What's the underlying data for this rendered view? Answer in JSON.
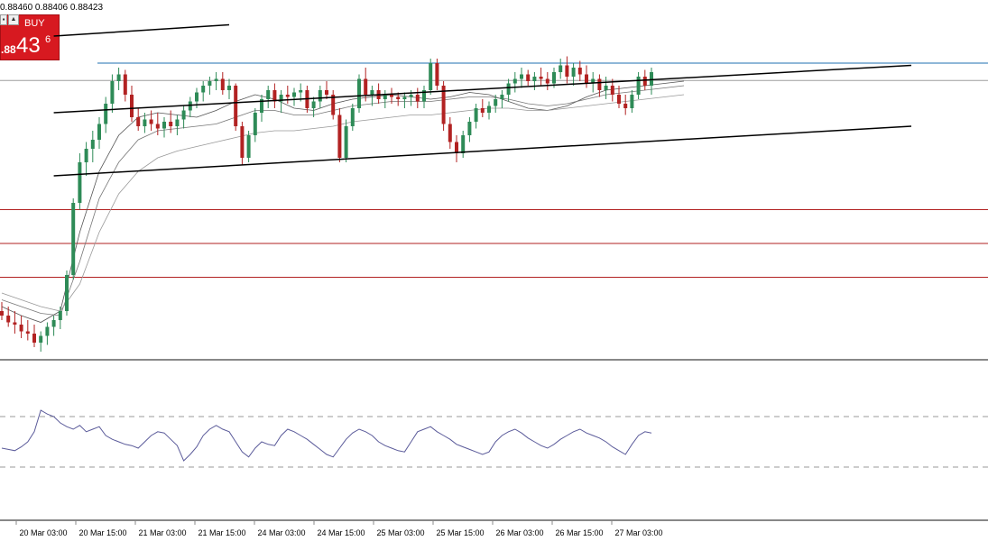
{
  "header": {
    "ohlc_text": "0.88460 0.88406 0.88423"
  },
  "trade_panel": {
    "buy_label": "BUY",
    "price_prefix": ".88",
    "price_big": "43",
    "price_sup": "6",
    "buy_color": "#d71920",
    "collapse_glyph": "▪",
    "up_glyph": "▲"
  },
  "colors": {
    "candle_up": "#2e8b57",
    "candle_down": "#b22222",
    "trendline": "#000000",
    "support_line": "#b22222",
    "resistance_line": "#1f6fb2",
    "current_price_line": "#9e9e9e",
    "rsi_line": "#5b5b9a"
  },
  "chart_data": {
    "type": "candlestick",
    "x_axis_labels": [
      "20 Mar 03:00",
      "20 Mar 15:00",
      "21 Mar 03:00",
      "21 Mar 15:00",
      "24 Mar 03:00",
      "24 Mar 15:00",
      "25 Mar 03:00",
      "25 Mar 15:00",
      "26 Mar 03:00",
      "26 Mar 15:00",
      "27 Mar 03:00"
    ],
    "x_axis_tick_centers": [
      48,
      114,
      180,
      246,
      312,
      378,
      444,
      510,
      576,
      642,
      708
    ],
    "candles": [
      [
        0,
        0.874,
        0.8744,
        0.8736,
        0.8738
      ],
      [
        1,
        0.8738,
        0.8742,
        0.8733,
        0.8735
      ],
      [
        2,
        0.8735,
        0.874,
        0.873,
        0.8734
      ],
      [
        3,
        0.8734,
        0.8738,
        0.8728,
        0.8731
      ],
      [
        4,
        0.8731,
        0.8736,
        0.8727,
        0.873
      ],
      [
        5,
        0.873,
        0.8734,
        0.8724,
        0.8726
      ],
      [
        6,
        0.8726,
        0.8731,
        0.8722,
        0.8729
      ],
      [
        7,
        0.8729,
        0.8735,
        0.8725,
        0.8733
      ],
      [
        8,
        0.8733,
        0.8738,
        0.8729,
        0.8736
      ],
      [
        9,
        0.8736,
        0.8742,
        0.8732,
        0.874
      ],
      [
        10,
        0.874,
        0.8758,
        0.8738,
        0.8756
      ],
      [
        11,
        0.8756,
        0.879,
        0.8754,
        0.8788
      ],
      [
        12,
        0.8788,
        0.881,
        0.8785,
        0.8806
      ],
      [
        13,
        0.8806,
        0.8815,
        0.88,
        0.8812
      ],
      [
        14,
        0.8812,
        0.882,
        0.8806,
        0.8816
      ],
      [
        15,
        0.8816,
        0.8826,
        0.8812,
        0.8823
      ],
      [
        16,
        0.8823,
        0.8835,
        0.8819,
        0.8832
      ],
      [
        17,
        0.8832,
        0.8845,
        0.8828,
        0.8842
      ],
      [
        18,
        0.8842,
        0.8848,
        0.8838,
        0.8845
      ],
      [
        19,
        0.8845,
        0.8847,
        0.8833,
        0.8836
      ],
      [
        20,
        0.8836,
        0.884,
        0.8824,
        0.8826
      ],
      [
        21,
        0.8826,
        0.883,
        0.882,
        0.8822
      ],
      [
        22,
        0.8822,
        0.8828,
        0.8819,
        0.8825
      ],
      [
        23,
        0.8825,
        0.8829,
        0.882,
        0.8823
      ],
      [
        24,
        0.8823,
        0.8828,
        0.8818,
        0.8821
      ],
      [
        25,
        0.8821,
        0.8826,
        0.8817,
        0.8824
      ],
      [
        26,
        0.8824,
        0.8829,
        0.8819,
        0.8822
      ],
      [
        27,
        0.8822,
        0.8827,
        0.8818,
        0.8825
      ],
      [
        28,
        0.8825,
        0.8831,
        0.8821,
        0.8829
      ],
      [
        29,
        0.8829,
        0.8835,
        0.8826,
        0.8833
      ],
      [
        30,
        0.8833,
        0.8839,
        0.883,
        0.8837
      ],
      [
        31,
        0.8837,
        0.8842,
        0.8833,
        0.884
      ],
      [
        32,
        0.884,
        0.8844,
        0.8836,
        0.8842
      ],
      [
        33,
        0.8842,
        0.8846,
        0.8838,
        0.8843
      ],
      [
        34,
        0.8843,
        0.8846,
        0.8836,
        0.8838
      ],
      [
        35,
        0.8838,
        0.8843,
        0.8834,
        0.884
      ],
      [
        36,
        0.884,
        0.8841,
        0.882,
        0.8822
      ],
      [
        37,
        0.8822,
        0.8824,
        0.8805,
        0.8808
      ],
      [
        38,
        0.8808,
        0.882,
        0.8806,
        0.8818
      ],
      [
        39,
        0.8818,
        0.883,
        0.8815,
        0.8828
      ],
      [
        40,
        0.8828,
        0.8836,
        0.8824,
        0.8834
      ],
      [
        41,
        0.8834,
        0.884,
        0.883,
        0.8838
      ],
      [
        42,
        0.8838,
        0.8841,
        0.883,
        0.8833
      ],
      [
        43,
        0.8833,
        0.8838,
        0.8828,
        0.8836
      ],
      [
        44,
        0.8836,
        0.884,
        0.8832,
        0.8835
      ],
      [
        45,
        0.8835,
        0.8839,
        0.8831,
        0.8837
      ],
      [
        46,
        0.8837,
        0.8841,
        0.8833,
        0.8838
      ],
      [
        47,
        0.8838,
        0.884,
        0.8828,
        0.883
      ],
      [
        48,
        0.883,
        0.8835,
        0.8826,
        0.8833
      ],
      [
        49,
        0.8833,
        0.884,
        0.883,
        0.8838
      ],
      [
        50,
        0.8838,
        0.8842,
        0.8834,
        0.8836
      ],
      [
        51,
        0.8836,
        0.8838,
        0.8825,
        0.8827
      ],
      [
        52,
        0.8827,
        0.883,
        0.8806,
        0.8808
      ],
      [
        53,
        0.8808,
        0.8825,
        0.8806,
        0.8822
      ],
      [
        54,
        0.8822,
        0.8832,
        0.882,
        0.883
      ],
      [
        55,
        0.883,
        0.8845,
        0.8828,
        0.8843
      ],
      [
        56,
        0.8843,
        0.8848,
        0.8833,
        0.8836
      ],
      [
        57,
        0.8836,
        0.884,
        0.8831,
        0.8838
      ],
      [
        58,
        0.8838,
        0.8841,
        0.8832,
        0.8834
      ],
      [
        59,
        0.8834,
        0.8838,
        0.883,
        0.8836
      ],
      [
        60,
        0.8836,
        0.8839,
        0.8832,
        0.8835
      ],
      [
        61,
        0.8835,
        0.8837,
        0.8831,
        0.8834
      ],
      [
        62,
        0.8834,
        0.8837,
        0.883,
        0.8835
      ],
      [
        63,
        0.8835,
        0.8838,
        0.8831,
        0.8836
      ],
      [
        64,
        0.8836,
        0.8839,
        0.883,
        0.8833
      ],
      [
        65,
        0.8833,
        0.884,
        0.883,
        0.8838
      ],
      [
        66,
        0.8838,
        0.8852,
        0.8836,
        0.885
      ],
      [
        67,
        0.885,
        0.8852,
        0.8838,
        0.884
      ],
      [
        68,
        0.884,
        0.8842,
        0.882,
        0.8823
      ],
      [
        69,
        0.8823,
        0.8826,
        0.8812,
        0.8815
      ],
      [
        70,
        0.8815,
        0.8818,
        0.8806,
        0.881
      ],
      [
        71,
        0.881,
        0.882,
        0.8808,
        0.8818
      ],
      [
        72,
        0.8818,
        0.8826,
        0.8815,
        0.8824
      ],
      [
        73,
        0.8824,
        0.8832,
        0.8821,
        0.883
      ],
      [
        74,
        0.883,
        0.8834,
        0.8826,
        0.8828
      ],
      [
        75,
        0.8828,
        0.8833,
        0.8825,
        0.8831
      ],
      [
        76,
        0.8831,
        0.8836,
        0.8828,
        0.8834
      ],
      [
        77,
        0.8834,
        0.8838,
        0.883,
        0.8836
      ],
      [
        78,
        0.8836,
        0.8843,
        0.8833,
        0.8841
      ],
      [
        79,
        0.8841,
        0.8846,
        0.8837,
        0.8843
      ],
      [
        80,
        0.8843,
        0.8848,
        0.8839,
        0.8845
      ],
      [
        81,
        0.8845,
        0.8847,
        0.884,
        0.8842
      ],
      [
        82,
        0.8842,
        0.8846,
        0.8838,
        0.8844
      ],
      [
        83,
        0.8844,
        0.8848,
        0.884,
        0.8843
      ],
      [
        84,
        0.8843,
        0.8846,
        0.8838,
        0.8841
      ],
      [
        85,
        0.8841,
        0.8848,
        0.8839,
        0.8846
      ],
      [
        86,
        0.8846,
        0.8852,
        0.8843,
        0.8849
      ],
      [
        87,
        0.8849,
        0.8853,
        0.8841,
        0.8844
      ],
      [
        88,
        0.8844,
        0.885,
        0.884,
        0.8848
      ],
      [
        89,
        0.8848,
        0.8851,
        0.8842,
        0.8845
      ],
      [
        90,
        0.8845,
        0.8849,
        0.8839,
        0.8841
      ],
      [
        91,
        0.8841,
        0.8846,
        0.8837,
        0.8843
      ],
      [
        92,
        0.8843,
        0.8845,
        0.8835,
        0.8838
      ],
      [
        93,
        0.8838,
        0.8844,
        0.8834,
        0.884
      ],
      [
        94,
        0.884,
        0.8843,
        0.8833,
        0.8836
      ],
      [
        95,
        0.8836,
        0.884,
        0.883,
        0.8832
      ],
      [
        96,
        0.8832,
        0.8836,
        0.8827,
        0.883
      ],
      [
        97,
        0.883,
        0.8838,
        0.8828,
        0.8836
      ],
      [
        98,
        0.8836,
        0.8846,
        0.8834,
        0.8844
      ],
      [
        99,
        0.8844,
        0.8847,
        0.8838,
        0.884
      ],
      [
        100,
        0.884,
        0.8848,
        0.8836,
        0.8846
      ]
    ],
    "horizontal_levels": {
      "resistance_blue": 0.885,
      "current_price": 0.88423,
      "support_red_1": 0.8785,
      "support_red_2": 0.877,
      "support_red_3": 0.8755
    },
    "moving_averages": [
      {
        "color": "#555555",
        "values": [
          0.8742,
          0.8738,
          0.8735,
          0.874,
          0.8775,
          0.8802,
          0.8818,
          0.8826,
          0.8828,
          0.8827,
          0.8826,
          0.8829,
          0.8833,
          0.8836,
          0.8834,
          0.883,
          0.8829,
          0.8832,
          0.8834,
          0.8835,
          0.8836,
          0.8835,
          0.8834,
          0.8835,
          0.8837,
          0.8836,
          0.8833,
          0.883,
          0.8829,
          0.8831,
          0.8835,
          0.8838,
          0.8839,
          0.884,
          0.8841,
          0.8842
        ]
      },
      {
        "color": "#777777",
        "values": [
          0.8745,
          0.8742,
          0.8739,
          0.8738,
          0.8762,
          0.879,
          0.8806,
          0.8816,
          0.882,
          0.8821,
          0.8822,
          0.8823,
          0.8826,
          0.8829,
          0.8829,
          0.8827,
          0.8827,
          0.8829,
          0.8831,
          0.8832,
          0.8833,
          0.8833,
          0.8833,
          0.8834,
          0.8835,
          0.8835,
          0.8834,
          0.8832,
          0.8831,
          0.8832,
          0.8834,
          0.8836,
          0.8837,
          0.8838,
          0.8839,
          0.884
        ]
      },
      {
        "color": "#999999",
        "values": [
          0.8748,
          0.8745,
          0.8742,
          0.874,
          0.8752,
          0.8775,
          0.8792,
          0.8802,
          0.8808,
          0.8811,
          0.8813,
          0.8815,
          0.8817,
          0.8819,
          0.882,
          0.882,
          0.8821,
          0.8822,
          0.8824,
          0.8825,
          0.8826,
          0.8827,
          0.8827,
          0.8828,
          0.8829,
          0.883,
          0.883,
          0.8829,
          0.8829,
          0.883,
          0.8831,
          0.8832,
          0.8833,
          0.8834,
          0.8835,
          0.8836
        ]
      }
    ],
    "trendlines": [
      {
        "name": "upper_channel",
        "from": [
          8,
          0.8828
        ],
        "to": [
          140,
          0.8849
        ]
      },
      {
        "name": "lower_channel",
        "from": [
          8,
          0.88
        ],
        "to": [
          140,
          0.8822
        ]
      },
      {
        "name": "top_partial",
        "from": [
          8,
          0.8862
        ],
        "to": [
          35,
          0.8867
        ]
      }
    ],
    "rsi": {
      "upper_level": 70,
      "lower_level": 30,
      "values": [
        45,
        44,
        43,
        46,
        50,
        58,
        75,
        72,
        70,
        65,
        62,
        60,
        63,
        58,
        60,
        62,
        55,
        52,
        50,
        48,
        47,
        45,
        50,
        55,
        58,
        57,
        52,
        47,
        35,
        40,
        46,
        55,
        60,
        63,
        60,
        58,
        50,
        42,
        38,
        45,
        50,
        48,
        47,
        55,
        60,
        58,
        55,
        52,
        48,
        44,
        40,
        38,
        45,
        52,
        57,
        60,
        58,
        55,
        50,
        47,
        45,
        43,
        42,
        50,
        58,
        60,
        62,
        58,
        55,
        52,
        48,
        46,
        44,
        42,
        40,
        42,
        50,
        55,
        58,
        60,
        57,
        53,
        50,
        47,
        45,
        48,
        52,
        55,
        58,
        60,
        57,
        55,
        53,
        50,
        46,
        43,
        40,
        48,
        55,
        58,
        57
      ]
    }
  }
}
